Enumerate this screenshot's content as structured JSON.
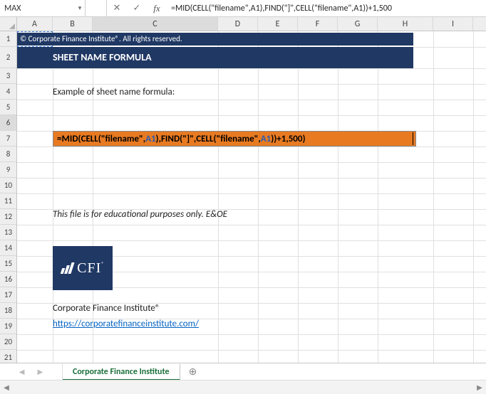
{
  "namebox": "MAX",
  "formula_bar": "=MID(CELL(\"filename\",A1),FIND(\"]\",CELL(\"filename\",A1))+1,500",
  "columns": [
    "A",
    "B",
    "C",
    "D",
    "E",
    "F",
    "G",
    "H",
    "I"
  ],
  "rows": [
    "1",
    "2",
    "3",
    "4",
    "5",
    "6",
    "7",
    "8",
    "9",
    "10",
    "11",
    "12",
    "13",
    "14",
    "15",
    "16",
    "17",
    "18",
    "19",
    "20",
    "21"
  ],
  "active_col": "C",
  "active_row": "6",
  "banner_copyright": "© Corporate Finance Institute®. All rights reserved.",
  "banner_title": "SHEET NAME FORMULA",
  "example_label": "Example of sheet name formula:",
  "formula_tokens": [
    {
      "t": "=",
      "c": "tok-func"
    },
    {
      "t": "MID",
      "c": "tok-func"
    },
    {
      "t": "(",
      "c": "tok-paren"
    },
    {
      "t": "CELL",
      "c": "tok-func"
    },
    {
      "t": "(",
      "c": "tok-paren"
    },
    {
      "t": "\"filename\"",
      "c": "tok-str"
    },
    {
      "t": ",",
      "c": "tok-func"
    },
    {
      "t": "A1",
      "c": "tok-ref"
    },
    {
      "t": ")",
      "c": "tok-paren"
    },
    {
      "t": ",",
      "c": "tok-func"
    },
    {
      "t": "FIND",
      "c": "tok-func"
    },
    {
      "t": "(",
      "c": "tok-paren"
    },
    {
      "t": "\"]\"",
      "c": "tok-str"
    },
    {
      "t": ",",
      "c": "tok-func"
    },
    {
      "t": "CELL",
      "c": "tok-func"
    },
    {
      "t": "(",
      "c": "tok-paren"
    },
    {
      "t": "\"filename\"",
      "c": "tok-str"
    },
    {
      "t": ",",
      "c": "tok-func"
    },
    {
      "t": "A1",
      "c": "tok-ref"
    },
    {
      "t": "))",
      "c": "tok-paren"
    },
    {
      "t": "+",
      "c": "tok-func"
    },
    {
      "t": "1,500",
      "c": "tok-num"
    },
    {
      "t": ")",
      "c": "tok-paren"
    }
  ],
  "disclaimer": "This file is for educational purposes only. E&OE",
  "logo_text": "CFI",
  "company": "Corporate Finance Institute®",
  "url": "https://corporatefinanceinstitute.com/",
  "sheet_tab": "Corporate Finance Institute",
  "icons": {
    "cancel": "✕",
    "enter": "✓",
    "fx": "fx",
    "dd": "▾",
    "tl": "◀",
    "tr": "▶",
    "plus": "⊕",
    "larr": "◀",
    "rarr": "▶"
  }
}
